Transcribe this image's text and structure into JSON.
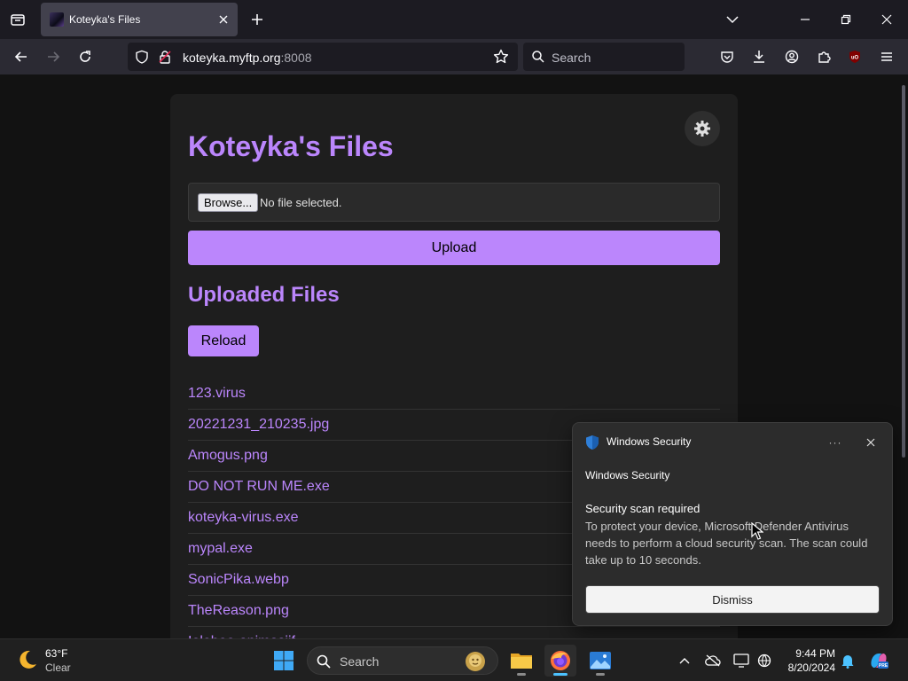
{
  "browser": {
    "tab_title": "Koteyka's Files",
    "url_host": "koteyka.myftp.org",
    "url_port": ":8008",
    "search_placeholder": "Search"
  },
  "page": {
    "title": "Koteyka's Files",
    "browse_label": "Browse...",
    "no_file_text": "No file selected.",
    "upload_label": "Upload",
    "section_title": "Uploaded Files",
    "reload_label": "Reload",
    "files": [
      "123.virus",
      "20221231_210235.jpg",
      "Amogus.png",
      "DO NOT RUN ME.exe",
      "koteyka-virus.exe",
      "mypal.exe",
      "SonicPika.webp",
      "TheReason.png",
      "Ielebee-animasiif"
    ]
  },
  "notification": {
    "app_name": "Windows Security",
    "source": "Windows Security",
    "title": "Security scan required",
    "body": "To protect your device, Microsoft Defender Antivirus needs to perform a cloud security scan. The scan could take up to 10 seconds.",
    "dismiss_label": "Dismiss",
    "more_label": "···"
  },
  "taskbar": {
    "weather_temp": "63°F",
    "weather_cond": "Clear",
    "search_placeholder": "Search",
    "time": "9:44 PM",
    "date": "8/20/2024"
  },
  "colors": {
    "accent": "#bb86fc",
    "card_bg": "#1e1e1e",
    "page_bg": "#121212"
  }
}
